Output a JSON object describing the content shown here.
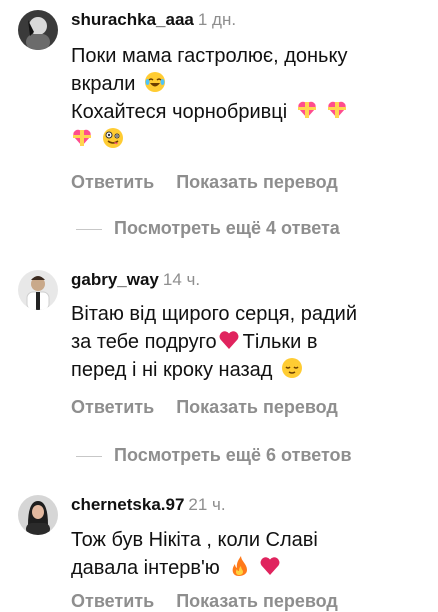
{
  "comments": [
    {
      "username": "shurachka_aaa",
      "time": "1 дн.",
      "lines": [
        "Поки мама гастролює, доньку",
        "вкрали",
        "Кохайтеся чорнобривці",
        ""
      ],
      "emojis": [
        "face-with-tears-of-joy",
        "heart-with-ribbon",
        "heart-with-ribbon",
        "heart-with-ribbon",
        "zany-face"
      ]
    },
    {
      "username": "gabry_way",
      "time": "14 ч.",
      "lines": [
        "Вітаю від щирого серця, радий",
        "за тебе подруго",
        "Тільки в",
        "перед і ні кроку назад"
      ],
      "emojis": [
        "red-heart",
        "relieved-face"
      ]
    },
    {
      "username": "chernetska.97",
      "time": "21 ч.",
      "lines": [
        "Тож був Нікіта , коли Славі",
        "давала інтерв'ю"
      ],
      "emojis": [
        "fire",
        "red-heart"
      ]
    }
  ],
  "actions": {
    "reply": "Ответить",
    "translate": "Показать перевод"
  },
  "more_replies": [
    "Посмотреть ещё 4 ответа",
    "Посмотреть ещё 6 ответов"
  ],
  "colors": {
    "text": "#111111",
    "secondary": "#8e8e8e",
    "heart": "#e0245e"
  }
}
